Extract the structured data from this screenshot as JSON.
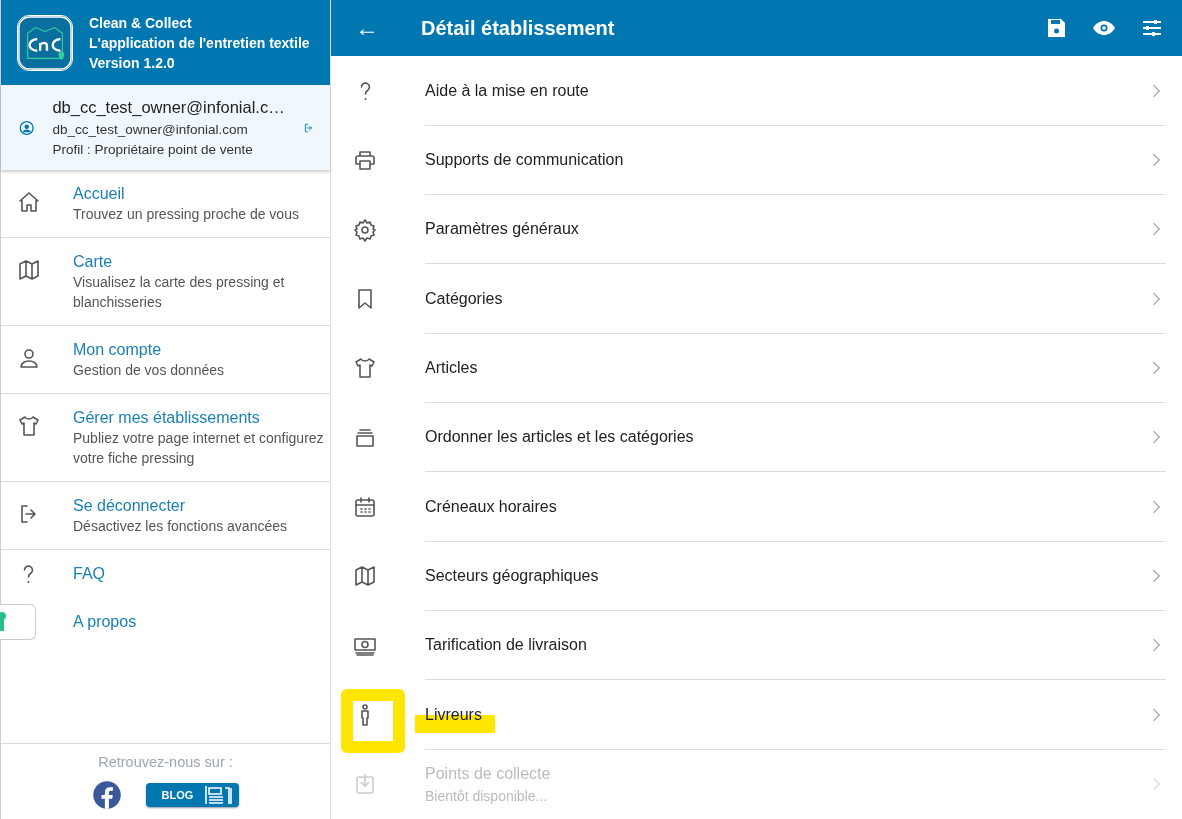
{
  "app": {
    "name": "Clean & Collect",
    "tagline": "L'application de l'entretien textile",
    "version": "Version 1.2.0"
  },
  "user": {
    "display": "db_cc_test_owner@infonial.c…",
    "email": "db_cc_test_owner@infonial.com",
    "profile": "Profil : Propriétaire point de vente"
  },
  "menu": [
    {
      "title": "Accueil",
      "subtitle": "Trouvez un pressing proche de vous"
    },
    {
      "title": "Carte",
      "subtitle": "Visualisez la carte des pressing et blanchisseries"
    },
    {
      "title": "Mon compte",
      "subtitle": "Gestion de vos données"
    },
    {
      "title": "Gérer mes établissements",
      "subtitle": "Publiez votre page internet et configurez votre fiche pressing"
    },
    {
      "title": "Se déconnecter",
      "subtitle": "Désactivez les fonctions avancées"
    },
    {
      "title": "FAQ"
    },
    {
      "title": "A propos"
    }
  ],
  "footer": {
    "text": "Retrouvez-nous sur :",
    "blog": "BLOG"
  },
  "header": {
    "back": "←",
    "title": "Détail établissement"
  },
  "items": [
    {
      "label": "Aide à la mise en route",
      "disabled": false,
      "highlighted": false
    },
    {
      "label": "Supports de communication",
      "disabled": false,
      "highlighted": false
    },
    {
      "label": "Paramètres généraux",
      "disabled": false,
      "highlighted": false
    },
    {
      "label": "Catégories",
      "disabled": false,
      "highlighted": false
    },
    {
      "label": "Articles",
      "disabled": false,
      "highlighted": false
    },
    {
      "label": "Ordonner les articles et les catégories",
      "disabled": false,
      "highlighted": false
    },
    {
      "label": "Créneaux horaires",
      "disabled": false,
      "highlighted": false
    },
    {
      "label": "Secteurs géographiques",
      "disabled": false,
      "highlighted": false
    },
    {
      "label": "Tarification de livraison",
      "disabled": false,
      "highlighted": false
    },
    {
      "label": "Livreurs",
      "disabled": false,
      "highlighted": true
    },
    {
      "label": "Points de collecte",
      "subtitle": "Bientôt disponible...",
      "disabled": true,
      "highlighted": false
    }
  ]
}
